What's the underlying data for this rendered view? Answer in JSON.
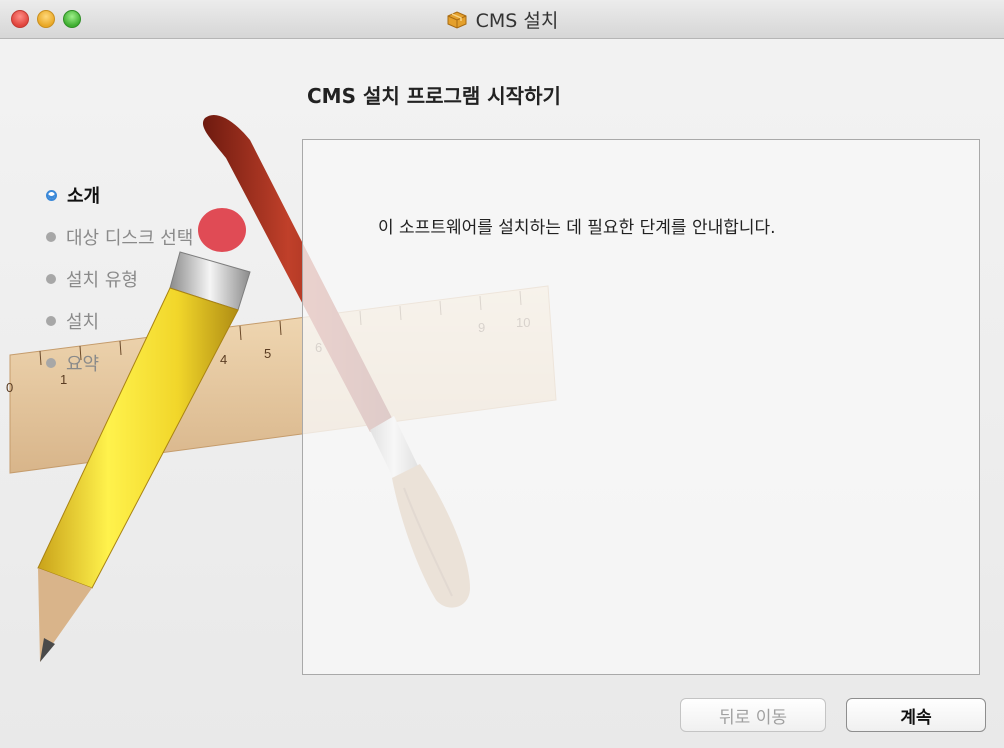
{
  "window": {
    "title": "CMS 설치",
    "icons": {
      "close": "close-traffic-light",
      "minimize": "minimize-traffic-light",
      "zoom": "zoom-traffic-light",
      "title": "package-icon"
    }
  },
  "main": {
    "heading": "CMS 설치 프로그램 시작하기",
    "content_text": "이 소프트웨어를 설치하는 데 필요한 단계를 안내합니다."
  },
  "sidebar": {
    "steps": [
      {
        "label": "소개",
        "active": true
      },
      {
        "label": "대상 디스크 선택",
        "active": false
      },
      {
        "label": "설치 유형",
        "active": false
      },
      {
        "label": "설치",
        "active": false
      },
      {
        "label": "요약",
        "active": false
      }
    ]
  },
  "background_art": {
    "ruler_ticks": [
      "0",
      "1",
      "4",
      "5",
      "6",
      "9",
      "10"
    ]
  },
  "buttons": {
    "back_label": "뒤로 이동",
    "continue_label": "계속"
  },
  "colors": {
    "accent": "#3a88d8",
    "inactive_text": "#8a8a8a"
  }
}
